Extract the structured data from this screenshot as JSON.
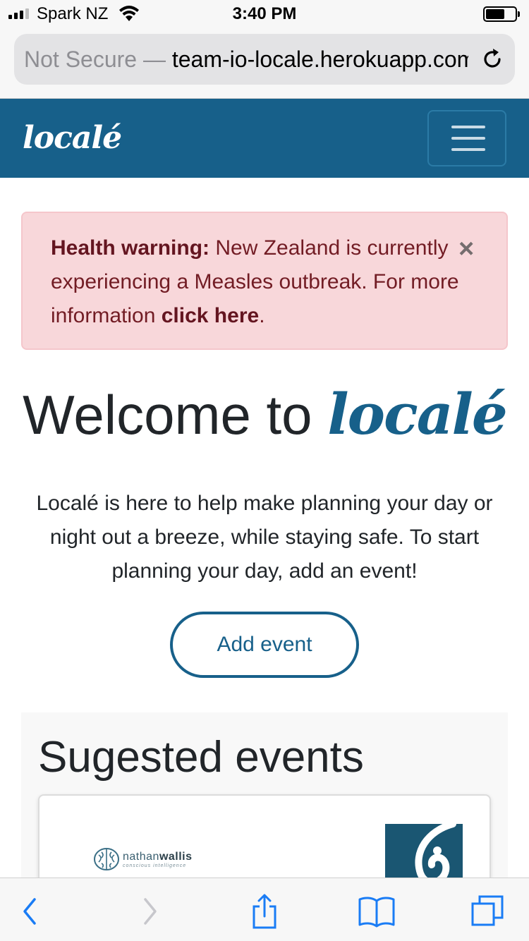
{
  "status_bar": {
    "carrier": "Spark NZ",
    "time": "3:40 PM",
    "battery_level": 0.65
  },
  "url_bar": {
    "security_label": "Not Secure —",
    "url": "team-io-locale.herokuapp.com"
  },
  "navbar": {
    "brand": "localé"
  },
  "alert": {
    "strong": "Health warning:",
    "text": "New Zealand is currently experiencing a Measles outbreak. For more information",
    "link": "click here",
    "period": ".",
    "close": "×"
  },
  "welcome": {
    "prefix": "Welcome to",
    "logo": "localé"
  },
  "intro": "Localé is here to help make planning your day or night out a breeze, while staying safe. To start planning your day, add an event!",
  "add_event_label": "Add event",
  "suggested": {
    "title": "Sugested events",
    "cards": [
      {
        "logo_light": "nathan",
        "logo_bold": "wallis",
        "logo_tagline": "conscious intelligence"
      }
    ]
  },
  "colors": {
    "brand": "#17608a",
    "alert_bg": "#f8d7da",
    "alert_text": "#721c24"
  }
}
